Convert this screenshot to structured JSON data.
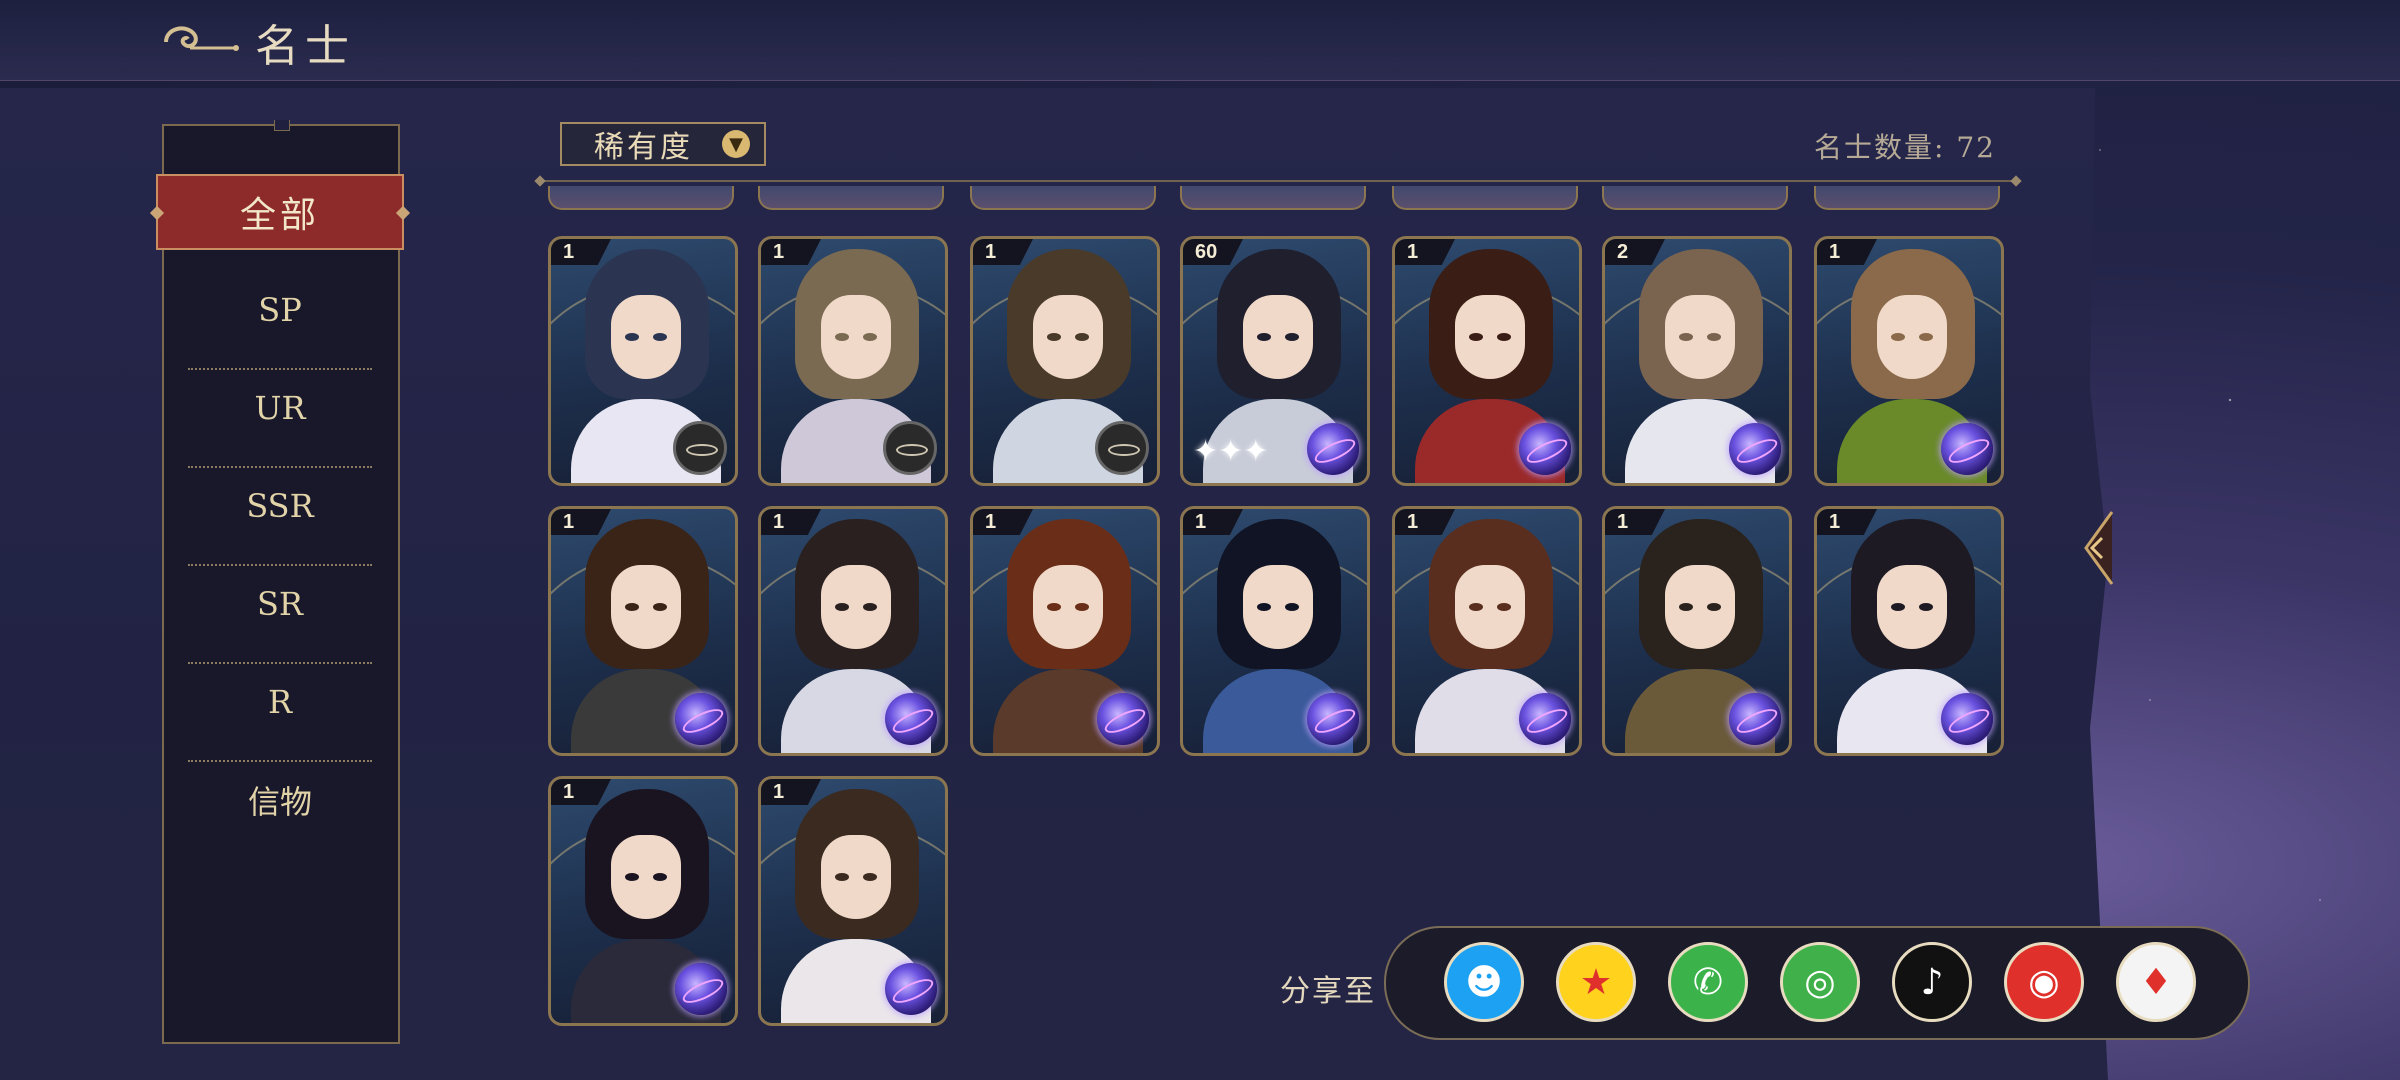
{
  "header": {
    "title": "名士"
  },
  "filter": {
    "rarity_label": "稀有度",
    "count_label": "名士数量: 72"
  },
  "sidebar": {
    "items": [
      {
        "label": "全部",
        "active": true
      },
      {
        "label": "SP"
      },
      {
        "label": "UR"
      },
      {
        "label": "SSR"
      },
      {
        "label": "SR"
      },
      {
        "label": "R"
      },
      {
        "label": "信物"
      }
    ]
  },
  "grid": {
    "cards": [
      {
        "level": "1",
        "badge": "compass-icon",
        "hair": "#2b3552",
        "cloth": "#e8e6f2"
      },
      {
        "level": "1",
        "badge": "compass-icon",
        "hair": "#7a6a52",
        "cloth": "#cfc8d8"
      },
      {
        "level": "1",
        "badge": "compass-icon",
        "hair": "#4a3a2a",
        "cloth": "#cfd6e2"
      },
      {
        "level": "60",
        "badge": "orb-icon",
        "hair": "#1f1f2e",
        "cloth": "#c8ccd8"
      },
      {
        "level": "1",
        "badge": "orb-icon",
        "hair": "#3a1e16",
        "cloth": "#9a2a2a"
      },
      {
        "level": "2",
        "badge": "orb-icon",
        "hair": "#7a6450",
        "cloth": "#e6e6ee"
      },
      {
        "level": "1",
        "badge": "orb-icon",
        "hair": "#8a6a4a",
        "cloth": "#6a8a2a"
      },
      {
        "level": "1",
        "badge": "orb-icon",
        "hair": "#3a2418",
        "cloth": "#3a3a3a"
      },
      {
        "level": "1",
        "badge": "orb-icon",
        "hair": "#2a2020",
        "cloth": "#d8d8e4"
      },
      {
        "level": "1",
        "badge": "orb-icon",
        "hair": "#6a2e18",
        "cloth": "#5a3a2a"
      },
      {
        "level": "1",
        "badge": "orb-icon",
        "hair": "#101424",
        "cloth": "#3a5a9a"
      },
      {
        "level": "1",
        "badge": "orb-icon",
        "hair": "#5a2e1e",
        "cloth": "#e0dde8"
      },
      {
        "level": "1",
        "badge": "orb-icon",
        "hair": "#2a221c",
        "cloth": "#6a5a3a"
      },
      {
        "level": "1",
        "badge": "orb-icon",
        "hair": "#1e1a24",
        "cloth": "#e8e6f0"
      },
      {
        "level": "1",
        "badge": "orb-icon",
        "hair": "#1a1420",
        "cloth": "#2a2a3a"
      },
      {
        "level": "1",
        "badge": "orb-icon",
        "hair": "#3a2a20",
        "cloth": "#eae6ea"
      }
    ]
  },
  "share": {
    "label": "分享至",
    "targets": [
      {
        "name": "qq-icon",
        "bg": "#1da1f2",
        "glyph": "☻"
      },
      {
        "name": "qzone-icon",
        "bg": "#ffd21e",
        "glyph": "★"
      },
      {
        "name": "wechat-icon",
        "bg": "#3cb34a",
        "glyph": "✆"
      },
      {
        "name": "moments-icon",
        "bg": "#40b04a",
        "glyph": "◎"
      },
      {
        "name": "douyin-icon",
        "bg": "#111111",
        "glyph": "♪"
      },
      {
        "name": "weibo-icon",
        "bg": "#e0302c",
        "glyph": "◉"
      },
      {
        "name": "gem-app-icon",
        "bg": "#f4f4f4",
        "glyph": "♦"
      }
    ]
  }
}
